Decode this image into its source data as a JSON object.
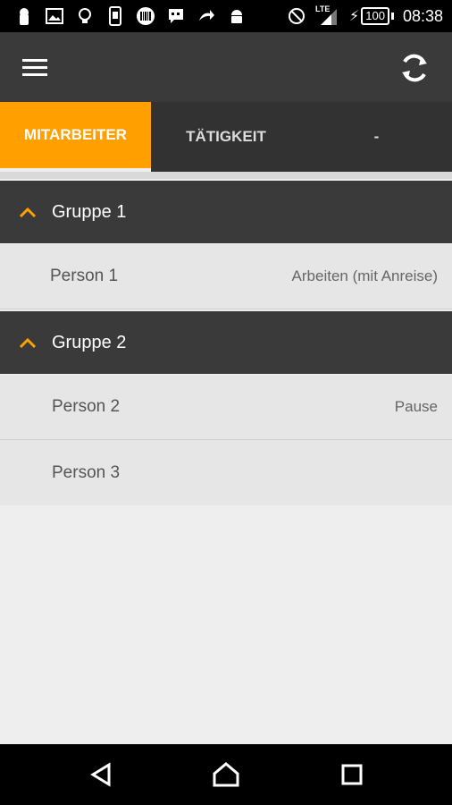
{
  "status_bar": {
    "icons_left": [
      "keyhole-icon",
      "image-icon",
      "bulb-icon",
      "phone-icon",
      "barcode-icon",
      "chat-icon",
      "share-icon",
      "android-icon"
    ],
    "lte_label": "LTE",
    "battery": "100",
    "time": "08:38"
  },
  "app_bar": {
    "menu_icon": "menu-icon",
    "sync_icon": "sync-icon"
  },
  "tabs": [
    {
      "label": "MITARBEITER",
      "active": true
    },
    {
      "label": "TÄTIGKEIT",
      "active": false
    },
    {
      "label": "-",
      "active": false
    }
  ],
  "groups": [
    {
      "label": "Gruppe 1",
      "people": [
        {
          "name": "Person 1",
          "status": "Arbeiten (mit Anreise)"
        }
      ]
    },
    {
      "label": "Gruppe 2",
      "people": [
        {
          "name": "Person 2",
          "status": "Pause"
        },
        {
          "name": "Person 3",
          "status": ""
        }
      ]
    }
  ],
  "colors": {
    "accent": "#ff9f00",
    "bar": "#3a3a3a",
    "tab_bg": "#323232",
    "row_bg": "#e6e6e6"
  }
}
